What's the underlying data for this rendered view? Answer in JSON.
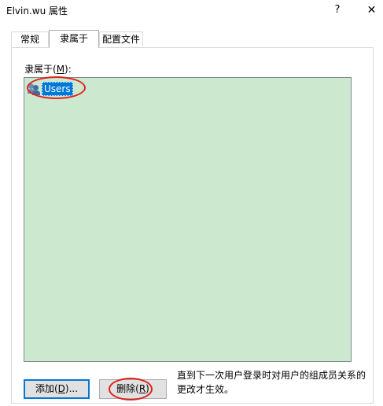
{
  "window": {
    "title": "Elvin.wu 属性",
    "help_label": "?",
    "close_label": "✕"
  },
  "tabs": [
    {
      "label": "常规",
      "active": false
    },
    {
      "label": "隶属于",
      "active": true
    },
    {
      "label": "配置文件",
      "active": false
    }
  ],
  "memberof": {
    "label_prefix": "隶属于(",
    "label_accel": "M",
    "label_suffix": "):",
    "items": [
      {
        "label": "Users",
        "icon": "group-icon",
        "selected": true
      }
    ]
  },
  "buttons": {
    "add_prefix": "添加(",
    "add_accel": "D",
    "add_suffix": ")...",
    "remove_prefix": "删除(",
    "remove_accel": "R",
    "remove_suffix": ")"
  },
  "note": "直到下一次用户登录时对用户的组成员关系的更改才生效。",
  "colors": {
    "listbox_background": "#cce8cf",
    "selection": "#0078d7",
    "annotation": "#e0201b"
  }
}
